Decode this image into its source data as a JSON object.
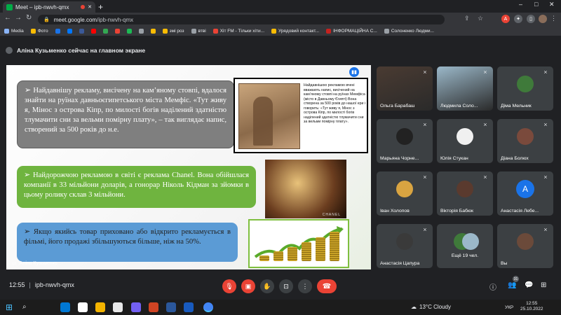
{
  "browser": {
    "tab_title": "Meet – ipb-nwvh-qmx",
    "new_tab": "+",
    "url_host": "meet.google.com",
    "url_path": "/ipb-nwvh-qmx",
    "window_controls": [
      "–",
      "□",
      "✕"
    ],
    "bookmarks": [
      {
        "label": "Media",
        "color": "#8ab4f8"
      },
      {
        "label": "Фото",
        "color": "#fbbc04"
      },
      {
        "label": "",
        "color": "#1a73e8"
      },
      {
        "label": "",
        "color": "#0077ff"
      },
      {
        "label": "",
        "color": "#3b5998"
      },
      {
        "label": "",
        "color": "#ff0000"
      },
      {
        "label": "",
        "color": "#34a853"
      },
      {
        "label": "",
        "color": "#ea4335"
      },
      {
        "label": "",
        "color": "#1db954"
      },
      {
        "label": "",
        "color": "#9aa0a6"
      },
      {
        "label": "",
        "color": "#fbbc04"
      },
      {
        "label": "змі роз",
        "color": "#fbbc04"
      },
      {
        "label": "втві",
        "color": "#9aa0a6"
      },
      {
        "label": "Хіт FM - Тільки хіти...",
        "color": "#ea4335"
      },
      {
        "label": "Урядовий контакт...",
        "color": "#fbbc04"
      },
      {
        "label": "ІНФОРМАЦІЙНА С...",
        "color": "#c5221f"
      },
      {
        "label": "Солоненко Людми...",
        "color": "#9aa0a6"
      }
    ]
  },
  "meet": {
    "presenting_text": "Аліна Кузьменко сейчас на главном экране",
    "presenter_label": "Аліна Кузьменко",
    "time": "12:55",
    "meeting_code": "ipb-nwvh-qmx",
    "participant_count": "31",
    "participants": [
      {
        "name": "Ольга Барабаш",
        "kind": "video",
        "color": "#4a3b32"
      },
      {
        "name": "Людмила Соло...",
        "kind": "video",
        "color": "#9bb8c9"
      },
      {
        "name": "Діма Мельник",
        "kind": "photo",
        "color": "#3f7a3a"
      },
      {
        "name": "Марьяна Чорне...",
        "kind": "photo",
        "color": "#222222"
      },
      {
        "name": "Юлія Стукан",
        "kind": "photo",
        "color": "#f0f0f0"
      },
      {
        "name": "Діана Болюх",
        "kind": "photo",
        "color": "#7a4a3c"
      },
      {
        "name": "Іван Холопов",
        "kind": "photo",
        "color": "#d9a441"
      },
      {
        "name": "Вікторія Бабюк",
        "kind": "photo",
        "color": "#5a3a2e"
      },
      {
        "name": "Анастасія Лебе...",
        "kind": "letter",
        "letter": "А",
        "color": "#1a73e8"
      },
      {
        "name": "Анастасія Цапура",
        "kind": "photo",
        "color": "#3a3a3a"
      },
      {
        "name": "Ещё 19 чел.",
        "kind": "group",
        "color": "#5f6368"
      },
      {
        "name": "Вы",
        "kind": "photo",
        "color": "#6b4a3a"
      }
    ]
  },
  "slide": {
    "bullet1": "Найдавнішу рекламу, висічену на кам’яному стовпі, вдалося знайти на руїнах давньоєгипетського міста Мемфіс. «Тут живу я, Мінос з острова Кіпр, по милості богів наділений здатністю тлумачити сни за вельми помірну плату», – так виглядає напис, створений за 500 років до н.е.",
    "bullet2": "Найдорожчою рекламою в світі є реклама Chanel. Вона обійшлася компанії в 33 мільйони доларів, а гонорар Ніколь Кідман за зйомки в цьому ролику склав 3 мільйони.",
    "bullet3": "Якщо якийсь товар приховано або відкрито рекламується в фільмі, його продажі збільшуються більше, ніж на 50%.",
    "image1_caption": "Найдавнішою рекламою вчені вважають напис, висічений на кам’яному стовпі на руїнах Мемфіса (місто в Давньому Єгипті) Вона створена за 500 років до нашої ери і говорить: «Тут живу я, Мінос з острова Кіпр, по милості богів наділений здатністю тлумачити сни за вельми помірну плату».",
    "image2_brand": "CHANEL"
  },
  "taskbar": {
    "weather": "13°C  Cloudy",
    "lang": "УКР",
    "clock_time": "12:55",
    "clock_date": "25.10.2022",
    "apps": [
      "#0078d4",
      "#ffffff",
      "#f4b400",
      "#e8e8e8",
      "#7360f2",
      "#d04423",
      "#2b579a",
      "#185abd",
      "#4285f4"
    ]
  },
  "colors": {
    "meet_bg": "#202124",
    "tile_bg": "#3c4043",
    "danger": "#ea4335",
    "accent": "#1a73e8"
  }
}
